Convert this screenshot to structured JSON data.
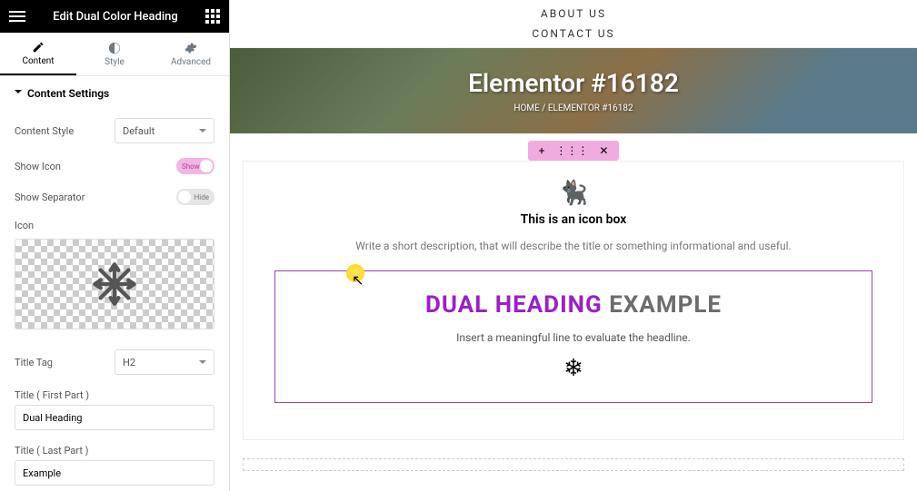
{
  "header": {
    "title": "Edit Dual Color Heading"
  },
  "tabs": {
    "content": "Content",
    "style": "Style",
    "advanced": "Advanced"
  },
  "section": {
    "head": "Content Settings"
  },
  "fields": {
    "content_style_label": "Content Style",
    "content_style_value": "Default",
    "show_icon_label": "Show Icon",
    "show_icon_value": "Show",
    "show_separator_label": "Show Separator",
    "show_separator_value": "Hide",
    "icon_label": "Icon",
    "title_tag_label": "Title Tag",
    "title_tag_value": "H2",
    "title_first_label": "Title ( First Part )",
    "title_first_value": "Dual Heading",
    "title_last_label": "Title ( Last Part )",
    "title_last_value": "Example"
  },
  "nav": {
    "about": "ABOUT US",
    "contact": "CONTACT US"
  },
  "hero": {
    "title": "Elementor #16182",
    "crumb_home": "HOME",
    "crumb_sep": "/",
    "crumb_current": "ELEMENTOR #16182"
  },
  "handle": {
    "add": "+",
    "drag": "⋮⋮⋮",
    "close": "✕"
  },
  "iconbox": {
    "title": "This is an icon box",
    "desc": "Write a short description, that will describe the title or something informational and useful."
  },
  "dual": {
    "first": "DUAL HEADING",
    "second": "EXAMPLE",
    "subtitle": "Insert a meaningful line to evaluate the headline."
  }
}
